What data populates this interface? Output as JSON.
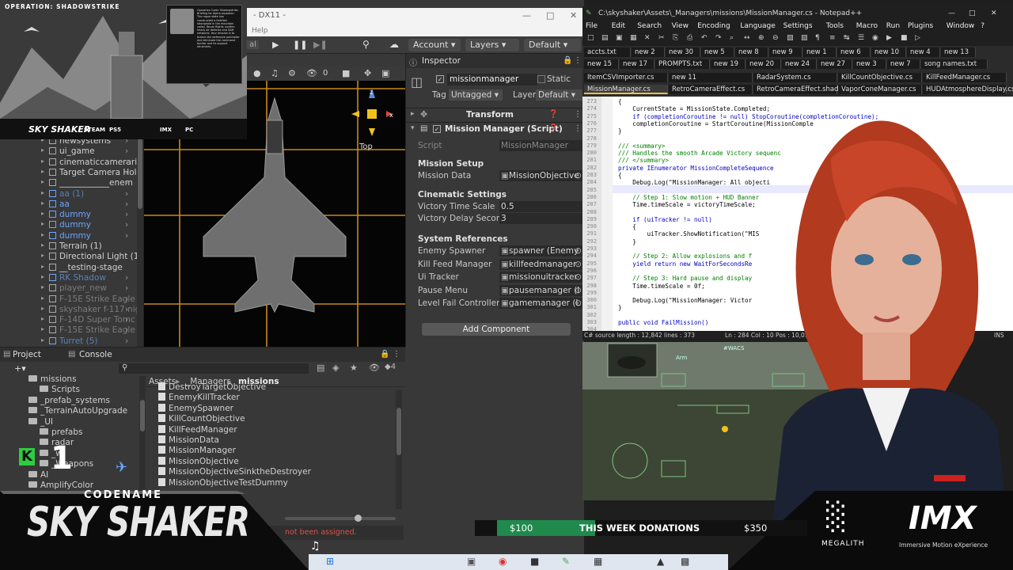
{
  "overlay": {
    "top_left_label": "OPERATION: SHADOWSTRIKE",
    "poster_logo": "SKY SHAKER",
    "poster_platforms": [
      "STEAM",
      "PS5",
      "",
      "IMX",
      "PC"
    ],
    "poster_card_text": "Operation Code: Shadowstrike. Briefing for Alpha squadron. The rogue state has constructed a fortified stronghold in the mountain valley. Recon flights confirm heavy air defense and SAM networks. Your mission is to breach the defensive perimeter and eliminate the command bunker and its support structures.",
    "codename_label": "CODENAME",
    "game_logo": "SKY SHAKER",
    "counter_letter": "K",
    "counter_number": "1",
    "donation_left": "$100",
    "donation_title": "THIS WEEK DONATIONS",
    "donation_right": "$350",
    "sponsor1": "MEGALITH",
    "sponsor2_logo": "IMX",
    "sponsor2_tagline": "Immersive Motion eXperience",
    "console_error": "not been assigned."
  },
  "unity": {
    "window_title": "- DX11 -",
    "menu_help": "Help",
    "toolbar": {
      "tab_partial": "al",
      "account": "Account",
      "layers": "Layers",
      "layout": "Default"
    },
    "scene": {
      "gizmo_label": "Top",
      "counter": "0"
    },
    "hierarchy": [
      {
        "label": "newsystems",
        "style": "normal"
      },
      {
        "label": "ui_game",
        "style": "normal"
      },
      {
        "label": "cinematiccameraric",
        "style": "normal"
      },
      {
        "label": "Target Camera Hold",
        "style": "normal"
      },
      {
        "label": "____________enem",
        "style": "normal"
      },
      {
        "label": "aa (1)",
        "style": "dimblue"
      },
      {
        "label": "aa",
        "style": "blue"
      },
      {
        "label": "dummy",
        "style": "blue"
      },
      {
        "label": "dummy",
        "style": "blue"
      },
      {
        "label": "dummy",
        "style": "blue"
      },
      {
        "label": "Terrain (1)",
        "style": "normal"
      },
      {
        "label": "Directional Light (1)",
        "style": "normal"
      },
      {
        "label": "__testing-stage",
        "style": "normal"
      },
      {
        "label": "RK Shadow",
        "style": "dimblue"
      },
      {
        "label": "player_new",
        "style": "dim"
      },
      {
        "label": "F-15E Strike Eagle",
        "style": "dim"
      },
      {
        "label": "skyshaker f-117 nig",
        "style": "dim"
      },
      {
        "label": "F-14D Super Tomc",
        "style": "dim"
      },
      {
        "label": "F-15E Strike Eagle",
        "style": "dim"
      },
      {
        "label": "Turret (5)",
        "style": "dimblue"
      }
    ],
    "inspector": {
      "tab": "Inspector",
      "object_name": "missionmanager",
      "static_label": "Static",
      "tag_label": "Tag",
      "tag_value": "Untagged",
      "layer_label": "Layer",
      "layer_value": "Default",
      "transform": "Transform",
      "component": "Mission Manager (Script)",
      "script_label": "Script",
      "script_value": "MissionManager",
      "sections": {
        "setup": "Mission Setup",
        "cinematic": "Cinematic Settings",
        "references": "System References"
      },
      "fields": [
        {
          "label": "Mission Data",
          "value": "MissionObjective"
        },
        {
          "label": "Victory Time Scale",
          "value": "0.5"
        },
        {
          "label": "Victory Delay Secon",
          "value": "3"
        },
        {
          "label": "Enemy Spawner",
          "value": "spawner (Enemy"
        },
        {
          "label": "Kill Feed Manager",
          "value": "killfeedmanager"
        },
        {
          "label": "Ui Tracker",
          "value": "missionuitracker"
        },
        {
          "label": "Pause Menu",
          "value": "pausemanager (I"
        },
        {
          "label": "Level Fail Controller",
          "value": "gamemanager (L"
        }
      ],
      "add_component": "Add Component"
    },
    "project": {
      "tab_project": "Project",
      "tab_console": "Console",
      "breadcrumb": [
        "Assets",
        "_Managers",
        "missions"
      ],
      "tree": [
        "missions",
        "Scripts",
        "_prefab_systems",
        "_TerrainAutoUpgrade",
        "_UI",
        "prefabs",
        "radar",
        "_wi",
        "_Weapons",
        "AI",
        "AmplifyColor"
      ],
      "files": [
        "DestroyTargetObjective",
        "EnemyKillTracker",
        "EnemySpawner",
        "KillCountObjective",
        "KillFeedManager",
        "MissionData",
        "MissionManager",
        "MissionObjective",
        "MissionObjectiveSinktheDestroyer",
        "MissionObjectiveTestDummy"
      ],
      "count": "4"
    }
  },
  "notepad": {
    "title": "C:\\skyshaker\\Assets\\_Managers\\missions\\MissionManager.cs - Notepad++",
    "menu": [
      "File",
      "Edit",
      "Search",
      "View",
      "Encoding",
      "Language",
      "Settings",
      "Tools",
      "Macro",
      "Run",
      "Plugins",
      "Window",
      "?"
    ],
    "tabs_row1": [
      "accts.txt",
      "new 2",
      "new 30",
      "new 5",
      "new 8",
      "new 9",
      "new 1",
      "new 6",
      "new 10",
      "new 4",
      "new 13"
    ],
    "tabs_row2": [
      "new 15",
      "new 17",
      "PROMPTS.txt",
      "new 19",
      "new 20",
      "new 24",
      "new 27",
      "new 3",
      "new 7",
      "song names.txt"
    ],
    "tabs_row3": [
      "ItemCSVImporter.cs",
      "new 11",
      "RadarSystem.cs",
      "KillCountObjective.cs",
      "KillFeedManager.cs"
    ],
    "tabs_row4": [
      "MissionManager.cs",
      "RetroCameraEffect.cs",
      "RetroCameraEffect.shader",
      "VaporConeManager.cs",
      "HUDAtmosphereDisplay.cs"
    ],
    "code": [
      {
        "n": "273",
        "t": "{"
      },
      {
        "n": "274",
        "t": "    CurrentState = MissionState.Completed;"
      },
      {
        "n": "275",
        "t": "    if (completionCoroutine != null) StopCoroutine(completionCoroutine);"
      },
      {
        "n": "276",
        "t": "    completionCoroutine = StartCoroutine(MissionComple"
      },
      {
        "n": "277",
        "t": "}"
      },
      {
        "n": "278",
        "t": ""
      },
      {
        "n": "279",
        "t": "/// <summary>"
      },
      {
        "n": "280",
        "t": "/// Handles the smooth Arcade Victory sequenc"
      },
      {
        "n": "281",
        "t": "/// </summary>"
      },
      {
        "n": "282",
        "t": "private IEnumerator MissionCompleteSequence"
      },
      {
        "n": "283",
        "t": "{"
      },
      {
        "n": "284",
        "t": "    Debug.Log(\"MissionManager: All objecti"
      },
      {
        "n": "285",
        "t": ""
      },
      {
        "n": "286",
        "t": "    // Step 1: Slow motion + HUD Banner"
      },
      {
        "n": "287",
        "t": "    Time.timeScale = victoryTimeScale;"
      },
      {
        "n": "288",
        "t": ""
      },
      {
        "n": "289",
        "t": "    if (uiTracker != null)"
      },
      {
        "n": "290",
        "t": "    {"
      },
      {
        "n": "291",
        "t": "        uiTracker.ShowNotification(\"MIS"
      },
      {
        "n": "292",
        "t": "    }"
      },
      {
        "n": "293",
        "t": ""
      },
      {
        "n": "294",
        "t": "    // Step 2: Allow explosions and f"
      },
      {
        "n": "295",
        "t": "    yield return new WaitForSecondsRe"
      },
      {
        "n": "296",
        "t": ""
      },
      {
        "n": "297",
        "t": "    // Step 3: Hard pause and display"
      },
      {
        "n": "298",
        "t": "    Time.timeScale = 0f;"
      },
      {
        "n": "299",
        "t": ""
      },
      {
        "n": "300",
        "t": "    Debug.Log(\"MissionManager: Victor"
      },
      {
        "n": "301",
        "t": "}"
      },
      {
        "n": "302",
        "t": ""
      },
      {
        "n": "303",
        "t": "public void FailMission()"
      },
      {
        "n": "304",
        "t": ""
      }
    ],
    "status_left": "C# source length : 12,842    lines : 373",
    "status_mid": "Ln : 284    Col : 10    Pos : 10,013",
    "status_right": "INS"
  },
  "game_hud": {
    "label": "Arm",
    "tag": "#WACS"
  },
  "colors": {
    "unity_bg": "#383838",
    "scene_grid": "#c9881a",
    "donation_green": "#1f8a4c",
    "banner_bg": "#0b0b0b",
    "counter_green": "#2ecc40"
  }
}
